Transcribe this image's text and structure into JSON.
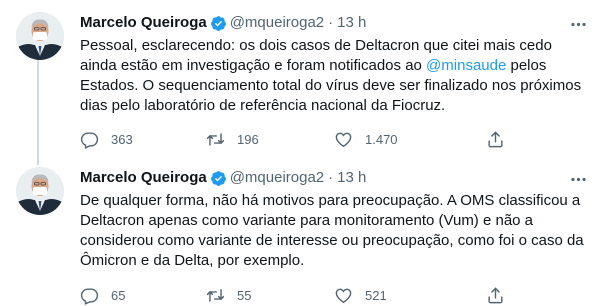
{
  "tweets": [
    {
      "name": "Marcelo Queiroga",
      "handle": "@mqueiroga2",
      "separator": "·",
      "time": "13 h",
      "text_before": "Pessoal, esclarecendo: os dois casos de Deltacron que citei mais cedo\nainda estão em investigação e foram notificados ao ",
      "mention": "@minsaude",
      "text_after": " pelos\nEstados. O sequenciamento total do vírus deve ser finalizado nos próximos\ndias pelo laboratório de referência nacional da Fiocruz.",
      "replies": "363",
      "retweets": "196",
      "likes": "1.470"
    },
    {
      "name": "Marcelo Queiroga",
      "handle": "@mqueiroga2",
      "separator": "·",
      "time": "13 h",
      "text": "De qualquer forma, não há motivos para preocupação. A OMS classificou a\nDeltacron apenas como variante para monitoramento (Vum) e não a\nconsiderou como variante de interesse ou preocupação, como foi o caso da\nÔmicron e da Delta, por exemplo.",
      "replies": "65",
      "retweets": "55",
      "likes": "521"
    }
  ],
  "icons": {
    "verified": "verified-badge-icon",
    "more": "more-options-icon",
    "reply": "reply-icon",
    "retweet": "retweet-icon",
    "like": "heart-icon",
    "share": "share-icon"
  },
  "colors": {
    "accent": "#1d9bf0",
    "text": "#0f1419",
    "muted": "#536471",
    "thread_line": "#cfd9de"
  }
}
